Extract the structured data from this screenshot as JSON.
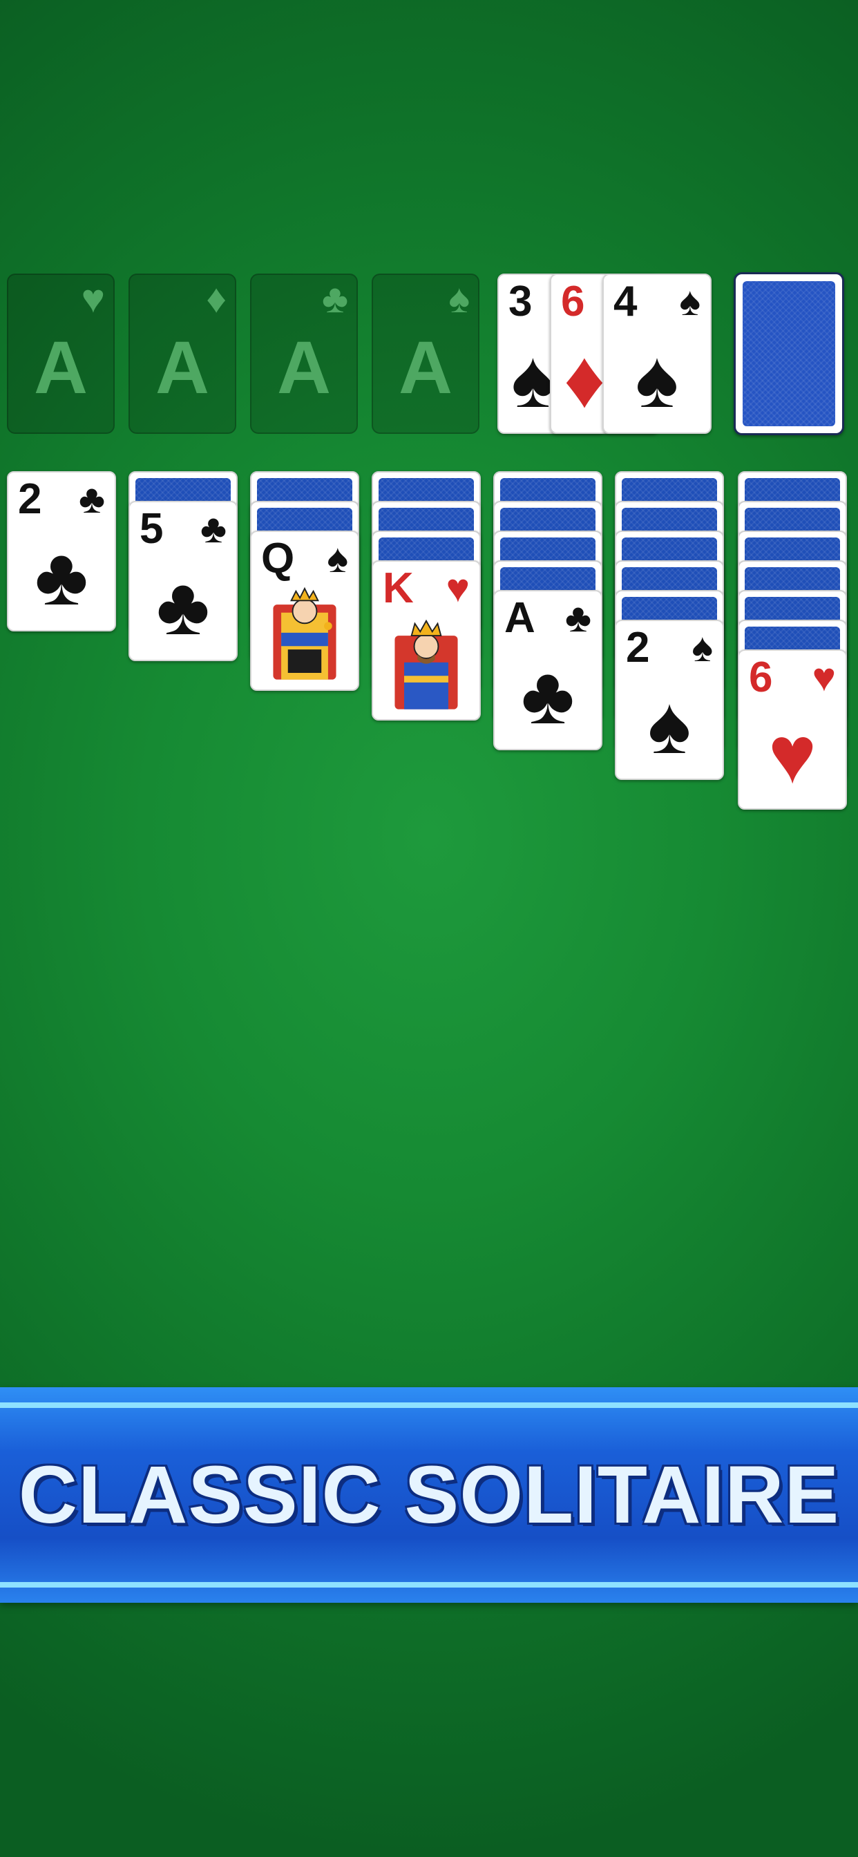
{
  "foundations": [
    {
      "letter": "A",
      "suit": "♥"
    },
    {
      "letter": "A",
      "suit": "♦"
    },
    {
      "letter": "A",
      "suit": "♣"
    },
    {
      "letter": "A",
      "suit": "♠"
    }
  ],
  "waste": [
    {
      "rank": "3",
      "suit": "♠"
    },
    {
      "rank": "6",
      "suit": "♦"
    },
    {
      "rank": "4",
      "suit": "♠"
    }
  ],
  "tableau": [
    {
      "face_down": 0,
      "card": {
        "rank": "2",
        "suit": "♣"
      }
    },
    {
      "face_down": 1,
      "card": {
        "rank": "5",
        "suit": "♣"
      }
    },
    {
      "face_down": 2,
      "card": {
        "rank": "Q",
        "suit": "♠"
      }
    },
    {
      "face_down": 3,
      "card": {
        "rank": "K",
        "suit": "♥"
      }
    },
    {
      "face_down": 4,
      "card": {
        "rank": "A",
        "suit": "♣"
      }
    },
    {
      "face_down": 5,
      "card": {
        "rank": "2",
        "suit": "♠"
      }
    },
    {
      "face_down": 6,
      "card": {
        "rank": "6",
        "suit": "♥"
      }
    }
  ],
  "banner": {
    "title": "CLASSIC SOLITAIRE"
  },
  "colors": {
    "felt": "#168a33",
    "card_back": "#1f4fb8",
    "red_suit": "#d42a2a",
    "banner": "#164fc6"
  }
}
